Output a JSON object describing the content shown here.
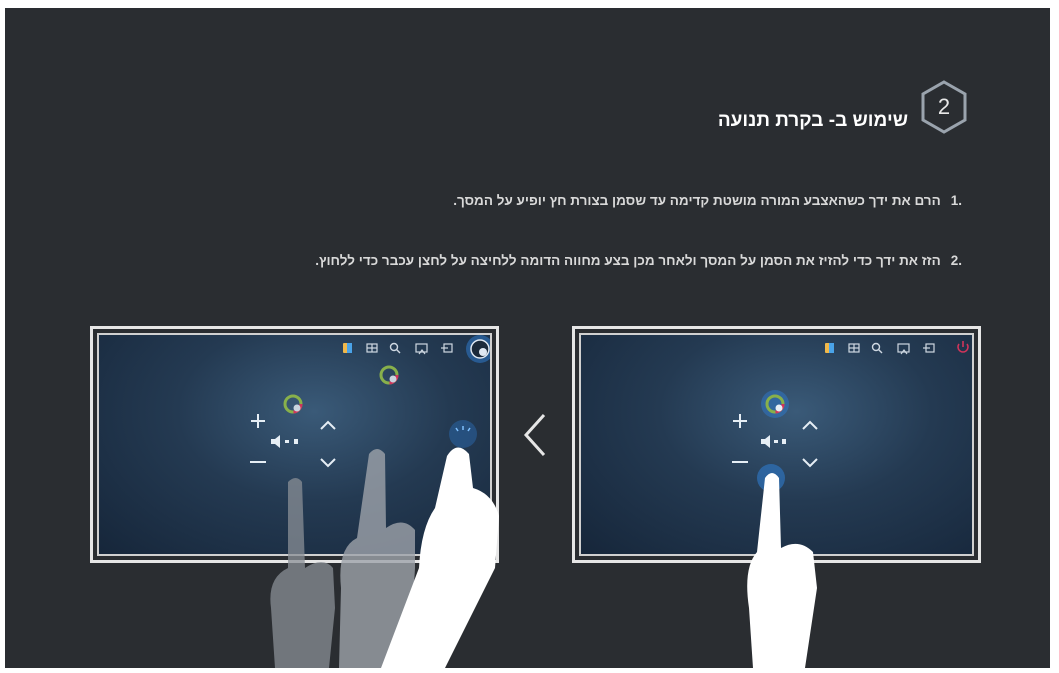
{
  "header": {
    "badge_number": "2",
    "title": "שימוש ב- בקרת תנועה"
  },
  "steps": [
    {
      "number": ".1",
      "text": "הרם את ידך כשהאצבע המורה מושטת קדימה עד שסמן בצורת חץ יופיע על המסך."
    },
    {
      "number": ".2",
      "text": "הזז את ידך כדי להזיז את הסמן על המסך ולאחר מכן בצע מחווה הדומה ללחיצה על לחצן עכבר כדי ללחוץ."
    }
  ],
  "icons": {
    "toolbar": [
      "smart-hub-cube-icon",
      "grid-icon",
      "search-icon",
      "source-icon",
      "exit-icon"
    ],
    "right_tv_corner": "power-icon",
    "left_tv_corner": "motion-pointer-icon",
    "controls": [
      "volume-plus-icon",
      "volume-minus-icon",
      "mute-icon",
      "channel-up-icon",
      "channel-down-icon"
    ],
    "between": "chevron-left-icon"
  },
  "colors": {
    "background": "#2a2d31",
    "screen": "#1f3349",
    "glow": "#2f7fd6",
    "power": "#d1345b",
    "text": "#d9d9d9"
  }
}
